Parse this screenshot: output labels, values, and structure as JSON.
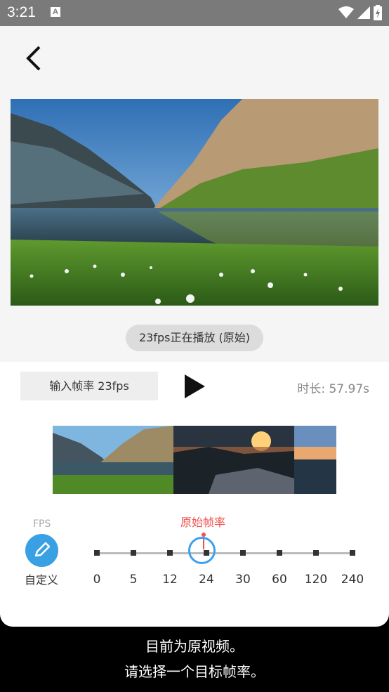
{
  "status_bar": {
    "time": "3:21",
    "notification_icon": "A"
  },
  "header": {
    "back_icon": "chevron-left-icon"
  },
  "preview": {
    "playing_text": "23fps正在播放 (原始)"
  },
  "controls": {
    "input_fps_label": "输入帧率 23fps",
    "duration_text": "时长: 57.97s"
  },
  "fps_picker": {
    "fps_label": "FPS",
    "custom_label": "自定义",
    "original_label": "原始帧率",
    "ticks": [
      "0",
      "5",
      "12",
      "24",
      "30",
      "60",
      "120",
      "240"
    ],
    "selected": "24",
    "accent_color": "#3ca0f0",
    "marker_color": "#ef5350"
  },
  "subtitle": {
    "line1": "目前为原视频。",
    "line2": "请选择一个目标帧率。"
  }
}
